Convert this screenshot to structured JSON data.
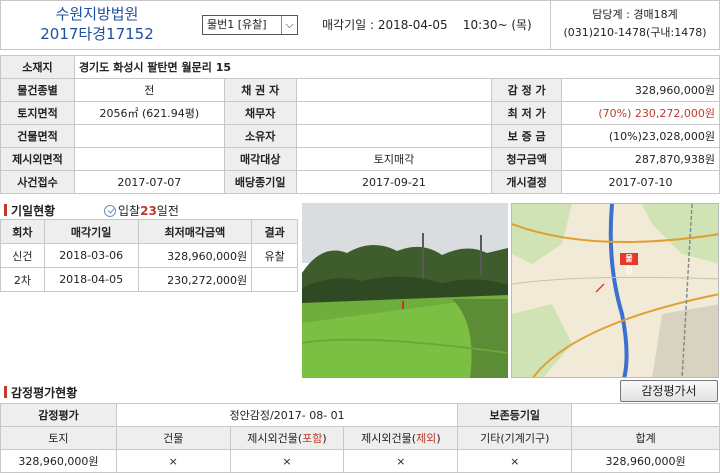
{
  "header": {
    "court": "수원지방법원",
    "case_no": "2017타경17152",
    "item_select": "물번1 [유찰]",
    "auction_label": "매각기일 :",
    "auction_date": "2018-04-05",
    "auction_time": "10:30~ (목)",
    "dept_label": "담당계 : 경매18계",
    "phone": "(031)210-1478(구내:1478)"
  },
  "main": {
    "address_label": "소재지",
    "address": "경기도 화성시 팔탄면 월문리 15",
    "rows": [
      {
        "l1": "물건종별",
        "v1": "전",
        "l2": "채 권 자",
        "v2": "",
        "l3": "감 정 가",
        "v3": "328,960,000원"
      },
      {
        "l1": "토지면적",
        "v1": "2056㎡ (621.94평)",
        "l2": "채무자",
        "v2": "",
        "l3": "최 저 가",
        "v3": "(70%) 230,272,000원"
      },
      {
        "l1": "건물면적",
        "v1": "",
        "l2": "소유자",
        "v2": "",
        "l3": "보 증 금",
        "v3": "(10%)23,028,000원"
      },
      {
        "l1": "제시외면적",
        "v1": "",
        "l2": "매각대상",
        "v2": "토지매각",
        "l3": "청구금액",
        "v3": "287,870,938원"
      },
      {
        "l1": "사건접수",
        "v1": "2017-07-07",
        "l2": "배당종기일",
        "v2": "2017-09-21",
        "l3": "개시결정",
        "v3": "2017-07-10"
      }
    ]
  },
  "history": {
    "title": "기일현황",
    "days_prefix": "입찰",
    "days_num": "23",
    "days_suffix": "일전",
    "headers": [
      "회차",
      "매각기일",
      "최저매각금액",
      "결과"
    ],
    "rows": [
      {
        "round": "신건",
        "date": "2018-03-06",
        "price": "328,960,000원",
        "result": "유찰"
      },
      {
        "round": "2차",
        "date": "2018-04-05",
        "price": "230,272,000원",
        "result": ""
      }
    ]
  },
  "map": {
    "marker": "물건"
  },
  "appraisal": {
    "title": "감정평가현황",
    "button": "감정평가서",
    "row1": {
      "l1": "감정평가",
      "v1": "정안감정/2017- 08- 01",
      "l2": "보존등기일",
      "v2": ""
    },
    "headers": [
      "토지",
      "건물",
      "제시외건물(",
      "포함",
      ")",
      "제시외건물(",
      "제외",
      ")",
      "기타(기계기구)",
      "합계"
    ],
    "values": [
      "328,960,000원",
      "×",
      "×",
      "×",
      "×",
      "328,960,000원"
    ]
  },
  "colors": {
    "accent_red": "#c0392b",
    "court_blue": "#1f4fa0",
    "label_bg": "#eeeeee"
  }
}
